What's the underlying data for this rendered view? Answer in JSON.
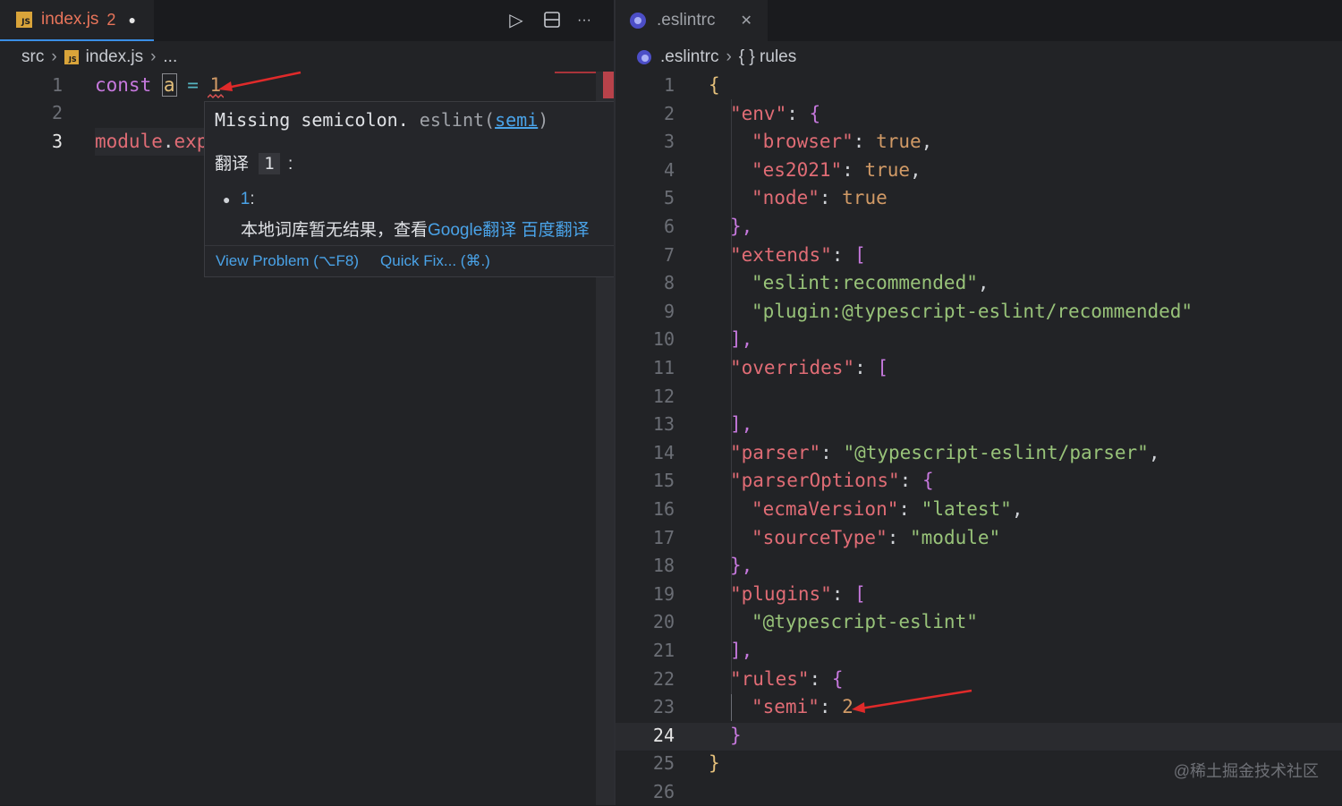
{
  "left_tab": {
    "filename": "index.js",
    "problems": "2",
    "dirty_glyph": "●",
    "icon": "js-file-icon"
  },
  "toolbar": {
    "run": "▷",
    "split": "split-editor-icon",
    "more": "···"
  },
  "left_breadcrumb": {
    "folder": "src",
    "file": "index.js",
    "more": "..."
  },
  "left_code": {
    "line_numbers": [
      "1",
      "2",
      "3"
    ],
    "line1": {
      "kw": "const",
      "var": "a",
      "op": "=",
      "num": "1"
    },
    "line3": {
      "obj": "module",
      "dot": ".",
      "prop": "exp"
    }
  },
  "hover": {
    "message": "Missing semicolon.",
    "source_prefix": "eslint(",
    "rule_link": "semi",
    "source_suffix": ")",
    "translate_label": "翻译",
    "translate_term": "1",
    "translate_colon": ":",
    "bullet_term": "1",
    "bullet_colon": ":",
    "result_text": "本地词库暂无结果，查看",
    "link_google": "Google翻译",
    "link_baidu": "百度翻译",
    "view_problem": "View Problem (⌥F8)",
    "quick_fix": "Quick Fix... (⌘.)"
  },
  "right_tab": {
    "filename": ".eslintrc",
    "close": "✕",
    "icon": "eslintrc-file-icon"
  },
  "right_breadcrumb": {
    "file": ".eslintrc",
    "symbol": "{ } rules"
  },
  "right_code": {
    "line_numbers": [
      "1",
      "2",
      "3",
      "4",
      "5",
      "6",
      "7",
      "8",
      "9",
      "10",
      "11",
      "12",
      "13",
      "14",
      "15",
      "16",
      "17",
      "18",
      "19",
      "20",
      "21",
      "22",
      "23",
      "24",
      "25",
      "26"
    ],
    "current_line": "24",
    "l1": "{",
    "l2k": "\"env\"",
    "l2b": "{",
    "l3k": "\"browser\"",
    "l3v": "true",
    "l4k": "\"es2021\"",
    "l4v": "true",
    "l5k": "\"node\"",
    "l5v": "true",
    "l6": "},",
    "l7k": "\"extends\"",
    "l7b": "[",
    "l8": "\"eslint:recommended\"",
    "l9": "\"plugin:@typescript-eslint/recommended\"",
    "l10": "],",
    "l11k": "\"overrides\"",
    "l11b": "[",
    "l13": "],",
    "l14k": "\"parser\"",
    "l14v": "\"@typescript-eslint/parser\"",
    "l15k": "\"parserOptions\"",
    "l15b": "{",
    "l16k": "\"ecmaVersion\"",
    "l16v": "\"latest\"",
    "l17k": "\"sourceType\"",
    "l17v": "\"module\"",
    "l18": "},",
    "l19k": "\"plugins\"",
    "l19b": "[",
    "l20": "\"@typescript-eslint\"",
    "l21": "],",
    "l22k": "\"rules\"",
    "l22b": "{",
    "l23k": "\"semi\"",
    "l23v": "2",
    "l24": "}",
    "l25": "}"
  },
  "watermark": "@稀土掘金技术社区",
  "colors": {
    "accent": "#3a8ee6",
    "error": "#e05252",
    "annotation_arrow": "#e02a2a"
  }
}
